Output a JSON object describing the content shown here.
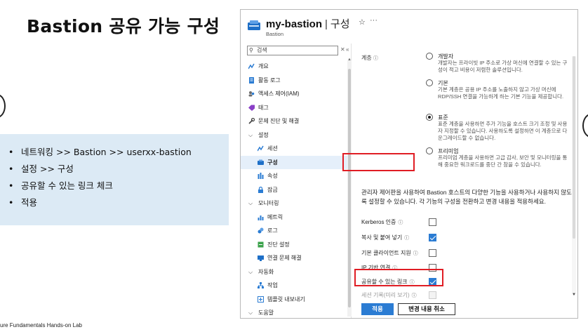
{
  "slide": {
    "title": "Bastion 공유 가능 구성",
    "steps": [
      "네트워킹 >> Bastion >> userxx-bastion",
      "설정 >> 구성",
      "공유할 수 있는 링크  체크",
      "적용"
    ],
    "footer": "ure Fundamentals Hands-on Lab"
  },
  "portal": {
    "resource_name": "my-bastion",
    "separator": "|",
    "page_name": "구성",
    "resource_type": "Bastion",
    "search_placeholder": "검색",
    "nav": [
      {
        "label": "개요",
        "icon": "overview-icon",
        "level": 0
      },
      {
        "label": "활동 로그",
        "icon": "activity-log-icon",
        "level": 0
      },
      {
        "label": "액세스 제어(IAM)",
        "icon": "iam-icon",
        "level": 0
      },
      {
        "label": "태그",
        "icon": "tag-icon",
        "level": 0
      },
      {
        "label": "문제 진단 및 해결",
        "icon": "wrench-icon",
        "level": 0
      },
      {
        "label": "설정",
        "icon": "chevron-down-icon",
        "level": "group"
      },
      {
        "label": "세션",
        "icon": "session-icon",
        "level": 1
      },
      {
        "label": "구성",
        "icon": "configuration-icon",
        "level": 1,
        "active": true
      },
      {
        "label": "속성",
        "icon": "properties-icon",
        "level": 1
      },
      {
        "label": "잠금",
        "icon": "lock-icon",
        "level": 1
      },
      {
        "label": "모니터링",
        "icon": "chevron-down-icon",
        "level": "group"
      },
      {
        "label": "메트릭",
        "icon": "metrics-icon",
        "level": 1
      },
      {
        "label": "로그",
        "icon": "logs-icon",
        "level": 1
      },
      {
        "label": "진단 설정",
        "icon": "diagnostic-settings-icon",
        "level": 1
      },
      {
        "label": "연결 문제 해결",
        "icon": "connection-troubleshoot-icon",
        "level": 1
      },
      {
        "label": "자동화",
        "icon": "chevron-down-icon",
        "level": "group"
      },
      {
        "label": "작업",
        "icon": "tasks-icon",
        "level": 1
      },
      {
        "label": "템플릿 내보내기",
        "icon": "export-template-icon",
        "level": 1
      },
      {
        "label": "도움말",
        "icon": "chevron-down-icon",
        "level": "group"
      }
    ],
    "tier_label": "계층",
    "tiers": [
      {
        "name": "개발자",
        "desc": "개발자는 프라이빗 IP 주소로 가상 머신에 연결할 수 있는 구성이 적고 비용이 저렴한 솔루션입니다.",
        "selected": false
      },
      {
        "name": "기본",
        "desc": "기본 계층은 공용 IP 주소를 노출하지 않고 가상 머신에 RDP/SSH 연결을 가능하게 하는 기본 기능을 제공합니다.",
        "selected": false
      },
      {
        "name": "표준",
        "desc": "표준 계층을 사용하면 추가 기능을 호스트 크기 조정 및 사용자 지정할 수 있습니다. 사용하도록 설정하면 이 계층으로 다운그레이드할 수 없습니다.",
        "selected": true
      },
      {
        "name": "프리미엄",
        "desc": "프리미엄 계층을 사용하면 고급 감사, 보안 및 모니터링을 통해 중요한 워크로드를 중단 간 참을 수 있습니다.",
        "selected": false
      }
    ],
    "features_desc": "관리자 제어판을 사용하여 Bastion 호스트의 다양한 기능을 사용하거나 사용하지 않도록 설정할 수 있습니다. 각 기능의 구성을 전환하고 변경 내용을 적용하세요.",
    "options": [
      {
        "label": "Kerberos 인증",
        "checked": false,
        "disabled": false
      },
      {
        "label": "복사 및 붙여 넣기",
        "checked": true,
        "disabled": false
      },
      {
        "label": "기본 클라이언트 지원",
        "checked": false,
        "disabled": false
      },
      {
        "label": "IP 기반 연결",
        "checked": false,
        "disabled": false
      },
      {
        "label": "공유할 수 있는 링크",
        "checked": true,
        "disabled": false
      },
      {
        "label": "세션 기록(미리 보기)",
        "checked": false,
        "disabled": true
      }
    ],
    "apply_label": "적용",
    "cancel_label": "변경 내용 취소",
    "colors": {
      "accent": "#2b7cd3",
      "highlight": "#e01d24",
      "instruction_bg": "#dceaf5"
    }
  }
}
